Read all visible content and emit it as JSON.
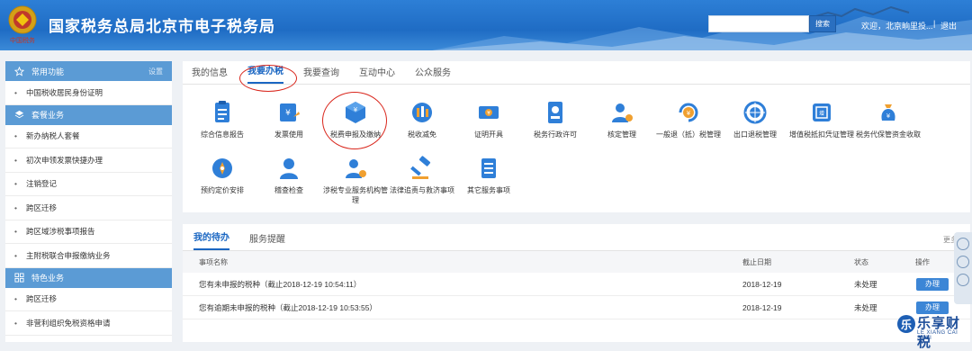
{
  "header": {
    "title": "国家税务总局北京市电子税务局",
    "emblem_caption": "中国税务",
    "search_button": "搜索",
    "welcome": "欢迎，北京晌里投...",
    "separator": "|",
    "logout": "退出"
  },
  "sidebar": {
    "sections": [
      {
        "title": "常用功能",
        "action": "设置",
        "icon": "star-icon"
      },
      {
        "title": "套餐业务",
        "icon": "layers-icon"
      },
      {
        "title": "特色业务",
        "icon": "grid-icon"
      }
    ],
    "common_items": [
      "中国税收居民身份证明"
    ],
    "package_items": [
      "新办纳税人套餐",
      "初次申领发票快捷办理",
      "注销登记",
      "跨区迁移",
      "跨区域涉税事项报告",
      "主附税联合申报缴纳业务"
    ],
    "special_items": [
      "跨区迁移",
      "非营利组织免税资格申请"
    ]
  },
  "tabs": [
    "我的信息",
    "我要办税",
    "我要查询",
    "互动中心",
    "公众服务"
  ],
  "active_tab": "我要办税",
  "services": [
    {
      "label": "综合信息报告",
      "icon": "clipboard-icon"
    },
    {
      "label": "发票使用",
      "icon": "invoice-icon"
    },
    {
      "label": "税费申报及缴纳",
      "icon": "cube-tax-icon"
    },
    {
      "label": "税收减免",
      "icon": "coins-icon"
    },
    {
      "label": "证明开具",
      "icon": "ticket-icon"
    },
    {
      "label": "税务行政许可",
      "icon": "id-card-icon"
    },
    {
      "label": "核定管理",
      "icon": "user-gear-icon"
    },
    {
      "label": "一般退（抵）税管理",
      "icon": "refund-icon"
    },
    {
      "label": "出口退税管理",
      "icon": "globe-icon"
    },
    {
      "label": "增值税抵扣凭证管理",
      "icon": "voucher-icon"
    },
    {
      "label": "税务代保管资金收取",
      "icon": "money-bag-icon"
    },
    {
      "label": "预约定价安排",
      "icon": "compass-icon"
    },
    {
      "label": "稽查检查",
      "icon": "inspector-icon"
    },
    {
      "label": "涉税专业服务机构管理",
      "icon": "agency-icon"
    },
    {
      "label": "法律追责与救济事项",
      "icon": "gavel-icon"
    },
    {
      "label": "其它服务事项",
      "icon": "list-icon"
    }
  ],
  "todo": {
    "tabs": [
      "我的待办",
      "服务提醒"
    ],
    "more": "更多",
    "columns": [
      "事项名称",
      "截止日期",
      "状态",
      "操作"
    ],
    "rows": [
      {
        "name": "您有未申报的税种（截止2018-12-19 10:54:11）",
        "date": "2018-12-19",
        "status": "未处理",
        "action": "办理"
      },
      {
        "name": "您有逾期未申报的税种（截止2018-12-19 10:53:55）",
        "date": "2018-12-19",
        "status": "未处理",
        "action": "办理"
      }
    ]
  },
  "watermark": {
    "text": "乐享财税",
    "sub": "LE XIANG CAI SHUI"
  },
  "colors": {
    "header_blue": "#1f6cc4",
    "accent_blue": "#1a66c2",
    "sidebar_head": "#5b9bd5",
    "annotation_red": "#d9261c"
  }
}
